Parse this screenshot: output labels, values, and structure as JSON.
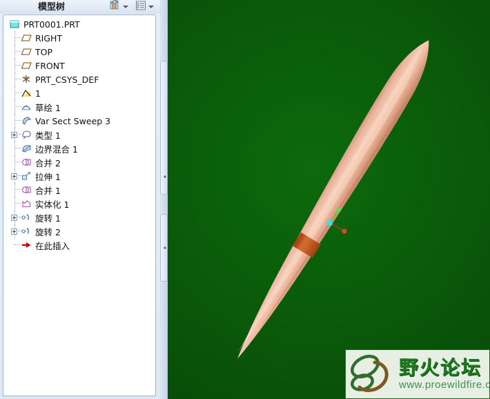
{
  "tree_panel": {
    "title": "模型树",
    "toolbar": [
      {
        "name": "filter-settings-icon",
        "label": "",
        "has_caret": true
      },
      {
        "name": "tree-columns-icon",
        "label": "",
        "has_caret": true
      }
    ],
    "items": [
      {
        "label": "PRT0001.PRT",
        "icon": "part-icon",
        "level": 0,
        "expander": "none"
      },
      {
        "label": "RIGHT",
        "icon": "datum-plane-icon",
        "level": 1,
        "expander": "none"
      },
      {
        "label": "TOP",
        "icon": "datum-plane-icon",
        "level": 1,
        "expander": "none"
      },
      {
        "label": "FRONT",
        "icon": "datum-plane-icon",
        "level": 1,
        "expander": "none"
      },
      {
        "label": "PRT_CSYS_DEF",
        "icon": "coord-system-icon",
        "level": 1,
        "expander": "none"
      },
      {
        "label": "1",
        "icon": "datum-curve-icon",
        "level": 1,
        "expander": "none"
      },
      {
        "label": "草绘 1",
        "icon": "sketch-icon",
        "level": 1,
        "expander": "none"
      },
      {
        "label": "Var Sect Sweep 3",
        "icon": "var-sect-sweep-icon",
        "level": 1,
        "expander": "none"
      },
      {
        "label": "类型 1",
        "icon": "type-surface-icon",
        "level": 1,
        "expander": "plus"
      },
      {
        "label": "边界混合 1",
        "icon": "boundary-blend-icon",
        "level": 1,
        "expander": "none"
      },
      {
        "label": "合并 2",
        "icon": "merge-icon",
        "level": 1,
        "expander": "none"
      },
      {
        "label": "拉伸 1",
        "icon": "extrude-icon",
        "level": 1,
        "expander": "plus"
      },
      {
        "label": "合并 1",
        "icon": "merge-icon",
        "level": 1,
        "expander": "none"
      },
      {
        "label": "实体化 1",
        "icon": "solidify-icon",
        "level": 1,
        "expander": "none"
      },
      {
        "label": "旋转 1",
        "icon": "revolve-icon",
        "level": 1,
        "expander": "plus"
      },
      {
        "label": "旋转 2",
        "icon": "revolve-icon",
        "level": 1,
        "expander": "plus"
      },
      {
        "label": "在此插入",
        "icon": "insert-here-icon",
        "level": 1,
        "expander": "none"
      }
    ]
  },
  "viewport": {
    "background_color": "#0a5c0a",
    "model_color": "#efb79c",
    "model_band_color": "#b4501e",
    "coord_system": {
      "origin_color": "#2fe3e3",
      "y_axis_color": "#3ddd3d",
      "x_axis_color": "#d9482e"
    }
  },
  "watermark": {
    "cn_text": "野火论坛",
    "url_text": "www.proewildfire.cn",
    "text_color": "#1e7a1e",
    "url_color": "#3f8f4f",
    "mark_name": "butterfly-leaf-logo"
  }
}
